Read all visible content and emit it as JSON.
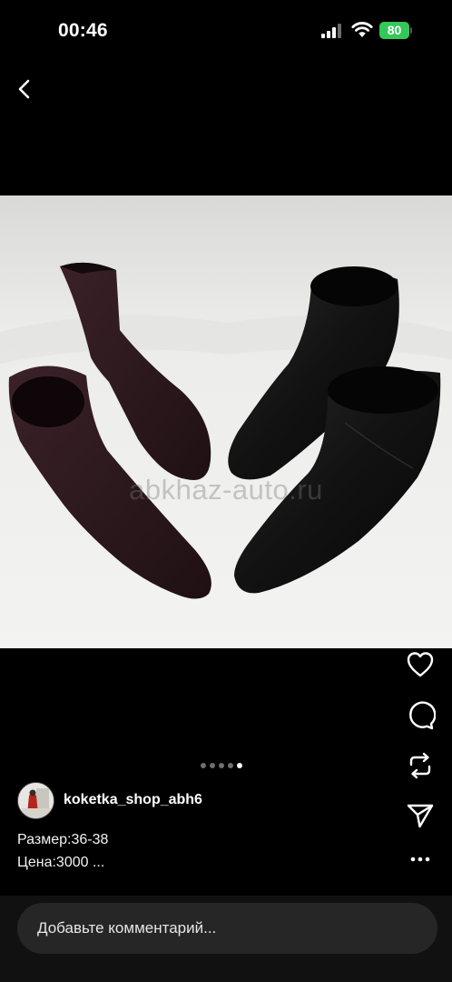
{
  "status_bar": {
    "time": "00:46",
    "battery": "80"
  },
  "post": {
    "image": {
      "description_icon": "photo-ankle-boots",
      "watermark": "abkhaz-auto.ru"
    },
    "carousel": {
      "total": 5,
      "active_index": 4
    },
    "author": {
      "username": "koketka_shop_abh6"
    },
    "caption": {
      "line1": "Размер:36-38",
      "line2": "Цена:3000 ..."
    }
  },
  "actions": [
    "heart-icon",
    "comment-icon",
    "repost-icon",
    "send-icon",
    "more-icon"
  ],
  "comment": {
    "placeholder": "Добавьте комментарий..."
  },
  "colors": {
    "background": "#000000",
    "battery_green": "#34c759",
    "input_bg": "#262626"
  }
}
